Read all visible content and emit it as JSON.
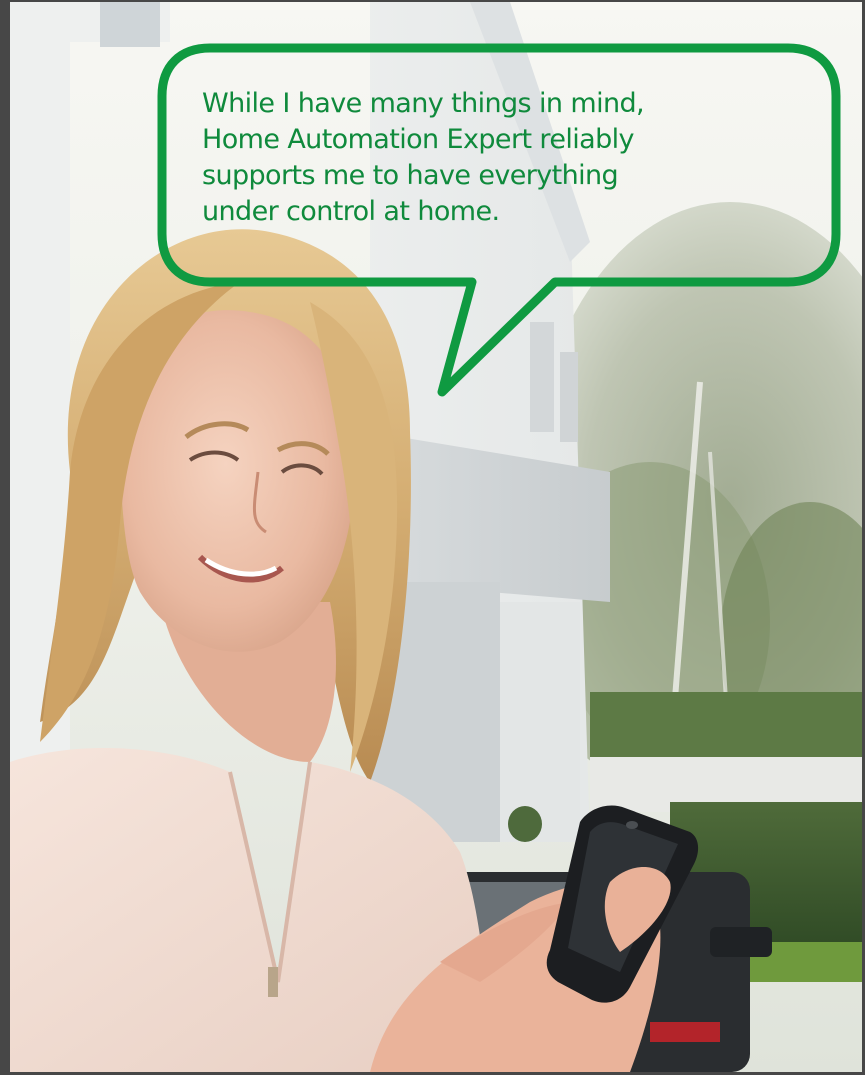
{
  "quote": {
    "lines": [
      "While I have many things in mind,",
      "Home Automation Expert reliably",
      "supports me to have  everything",
      "under control at home."
    ]
  },
  "colors": {
    "bubble_border": "#0f9a41",
    "quote_text": "#0f8a3c"
  }
}
